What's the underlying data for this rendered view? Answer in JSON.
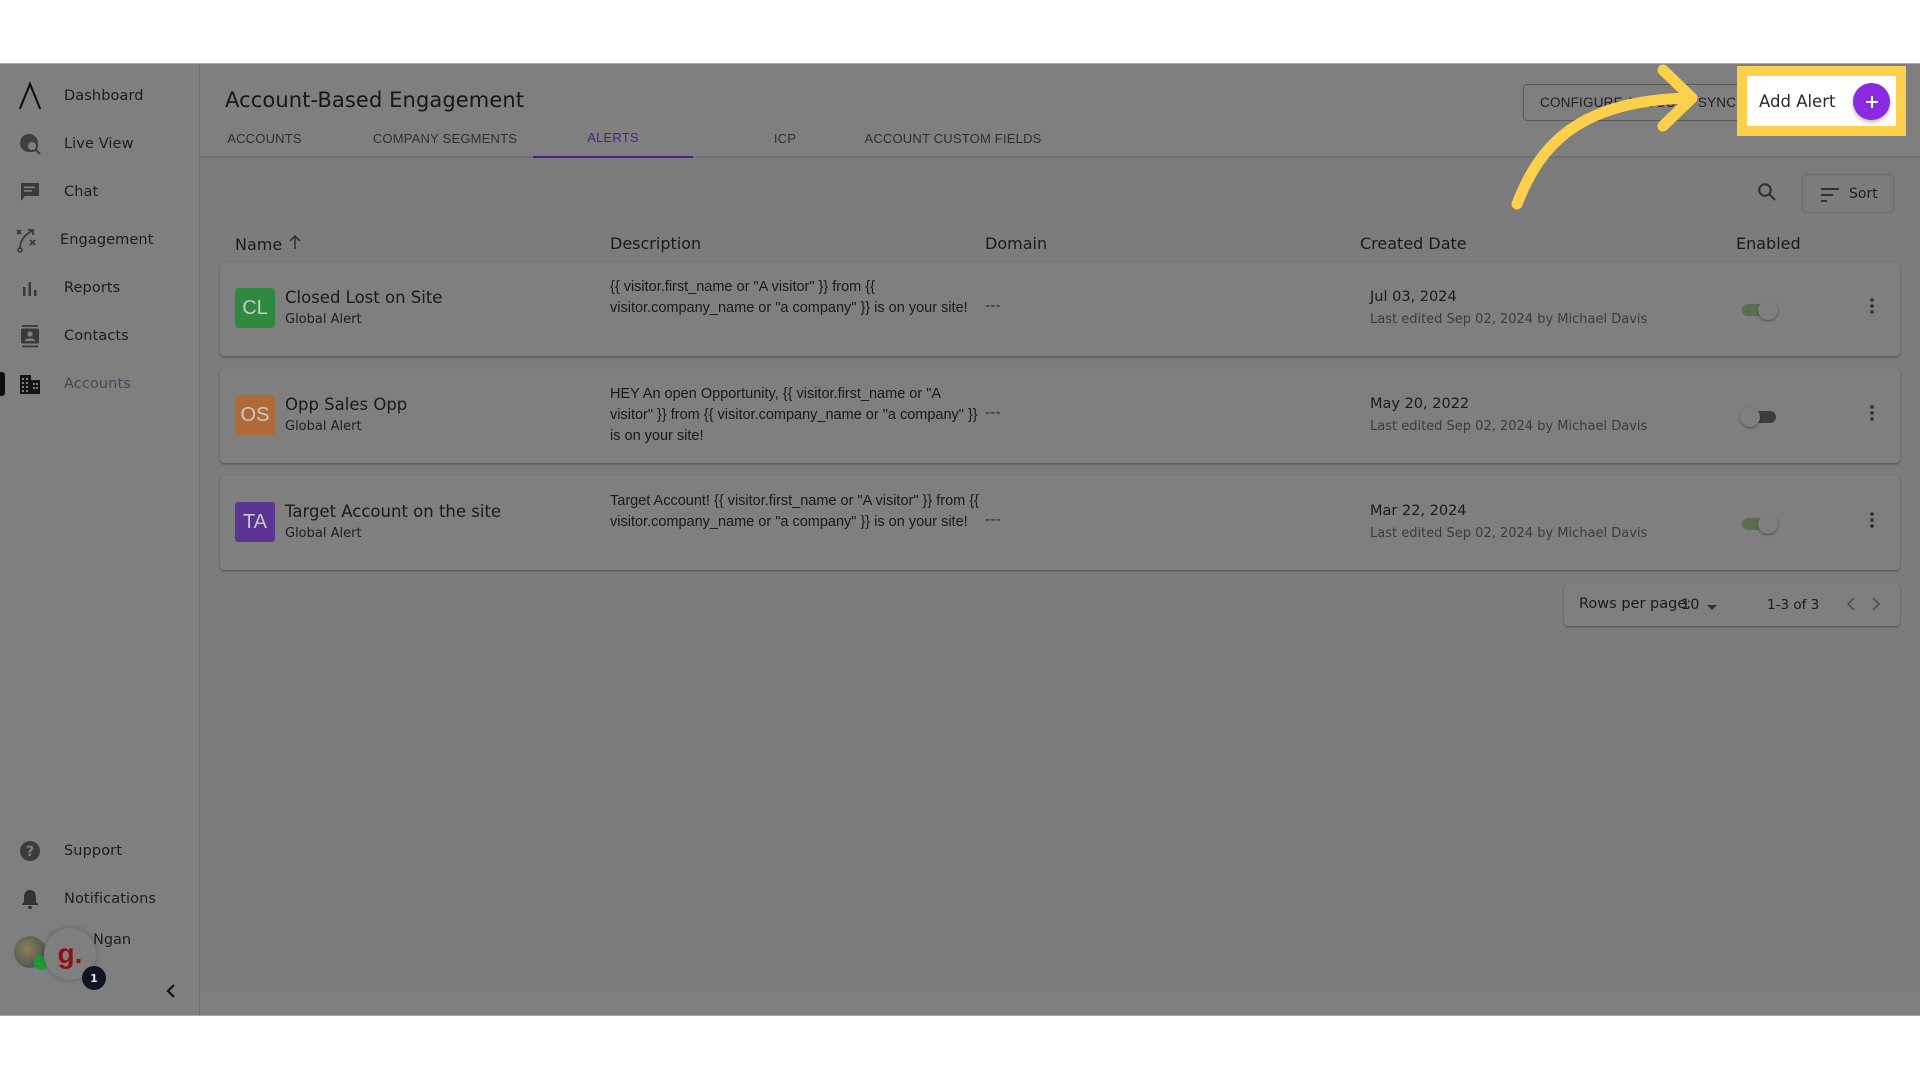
{
  "sidebar": {
    "items": [
      {
        "label": "Dashboard",
        "icon": "logo-caret-icon"
      },
      {
        "label": "Live View",
        "icon": "globe-search-icon"
      },
      {
        "label": "Chat",
        "icon": "chat-icon"
      },
      {
        "label": "Engagement",
        "icon": "strategy-icon"
      },
      {
        "label": "Reports",
        "icon": "bar-chart-icon"
      },
      {
        "label": "Contacts",
        "icon": "contacts-icon"
      },
      {
        "label": "Accounts",
        "icon": "building-icon",
        "active": true
      }
    ],
    "bottom_items": [
      {
        "label": "Support",
        "icon": "help-circle-icon"
      },
      {
        "label": "Notifications",
        "icon": "bell-icon"
      }
    ],
    "user": {
      "name": "Ngan",
      "bubble_letter": "g.",
      "badge_count": "1"
    },
    "collapse_icon": "chevron-left-icon"
  },
  "header": {
    "title": "Account-Based Engagement",
    "tabs": [
      {
        "label": "ACCOUNTS"
      },
      {
        "label": "COMPANY SEGMENTS"
      },
      {
        "label": "ALERTS",
        "active": true
      },
      {
        "label": "ICP"
      },
      {
        "label": "ACCOUNT CUSTOM FIELDS"
      }
    ],
    "configure_button": "CONFIGURE ACCOUNT SYNC",
    "add_alert_button": "Add Alert"
  },
  "toolbar": {
    "search_icon": "search-icon",
    "sort_label": "Sort"
  },
  "table": {
    "columns": {
      "name": "Name",
      "description": "Description",
      "domain": "Domain",
      "created": "Created Date",
      "enabled": "Enabled"
    },
    "rows": [
      {
        "initials": "CL",
        "avatar_color": "#2f8a3f",
        "name": "Closed Lost on Site",
        "type": "Global Alert",
        "description": "{{ visitor.first_name or \"A visitor\" }} from {{ visitor.company_name or \"a company\" }} is on your site!",
        "domain": "---",
        "created": "Jul 03, 2024",
        "edited": "Last edited Sep 02, 2024 by Michael Davis",
        "enabled": true
      },
      {
        "initials": "OS",
        "avatar_color": "#b06a35",
        "name": "Opp Sales Opp",
        "type": "Global Alert",
        "description": "HEY An open Opportunity, {{ visitor.first_name or \"A visitor\" }} from {{ visitor.company_name or \"a company\" }} is on your site!",
        "domain": "---",
        "created": "May 20, 2022",
        "edited": "Last edited Sep 02, 2024 by Michael Davis",
        "enabled": false
      },
      {
        "initials": "TA",
        "avatar_color": "#5b3591",
        "name": "Target Account on the site",
        "type": "Global Alert",
        "description": "Target Account! {{ visitor.first_name or \"A visitor\" }} from {{ visitor.company_name or \"a company\" }} is on your site!",
        "domain": "---",
        "created": "Mar 22, 2024",
        "edited": "Last edited Sep 02, 2024 by Michael Davis",
        "enabled": true
      }
    ]
  },
  "pagination": {
    "rows_per_page_label": "Rows per page:",
    "rows_per_page_value": "10",
    "range": "1-3 of 3"
  },
  "colors": {
    "accent": "#8a2be2",
    "highlight": "#fdd04b",
    "active_tab": "#4b1f90"
  }
}
